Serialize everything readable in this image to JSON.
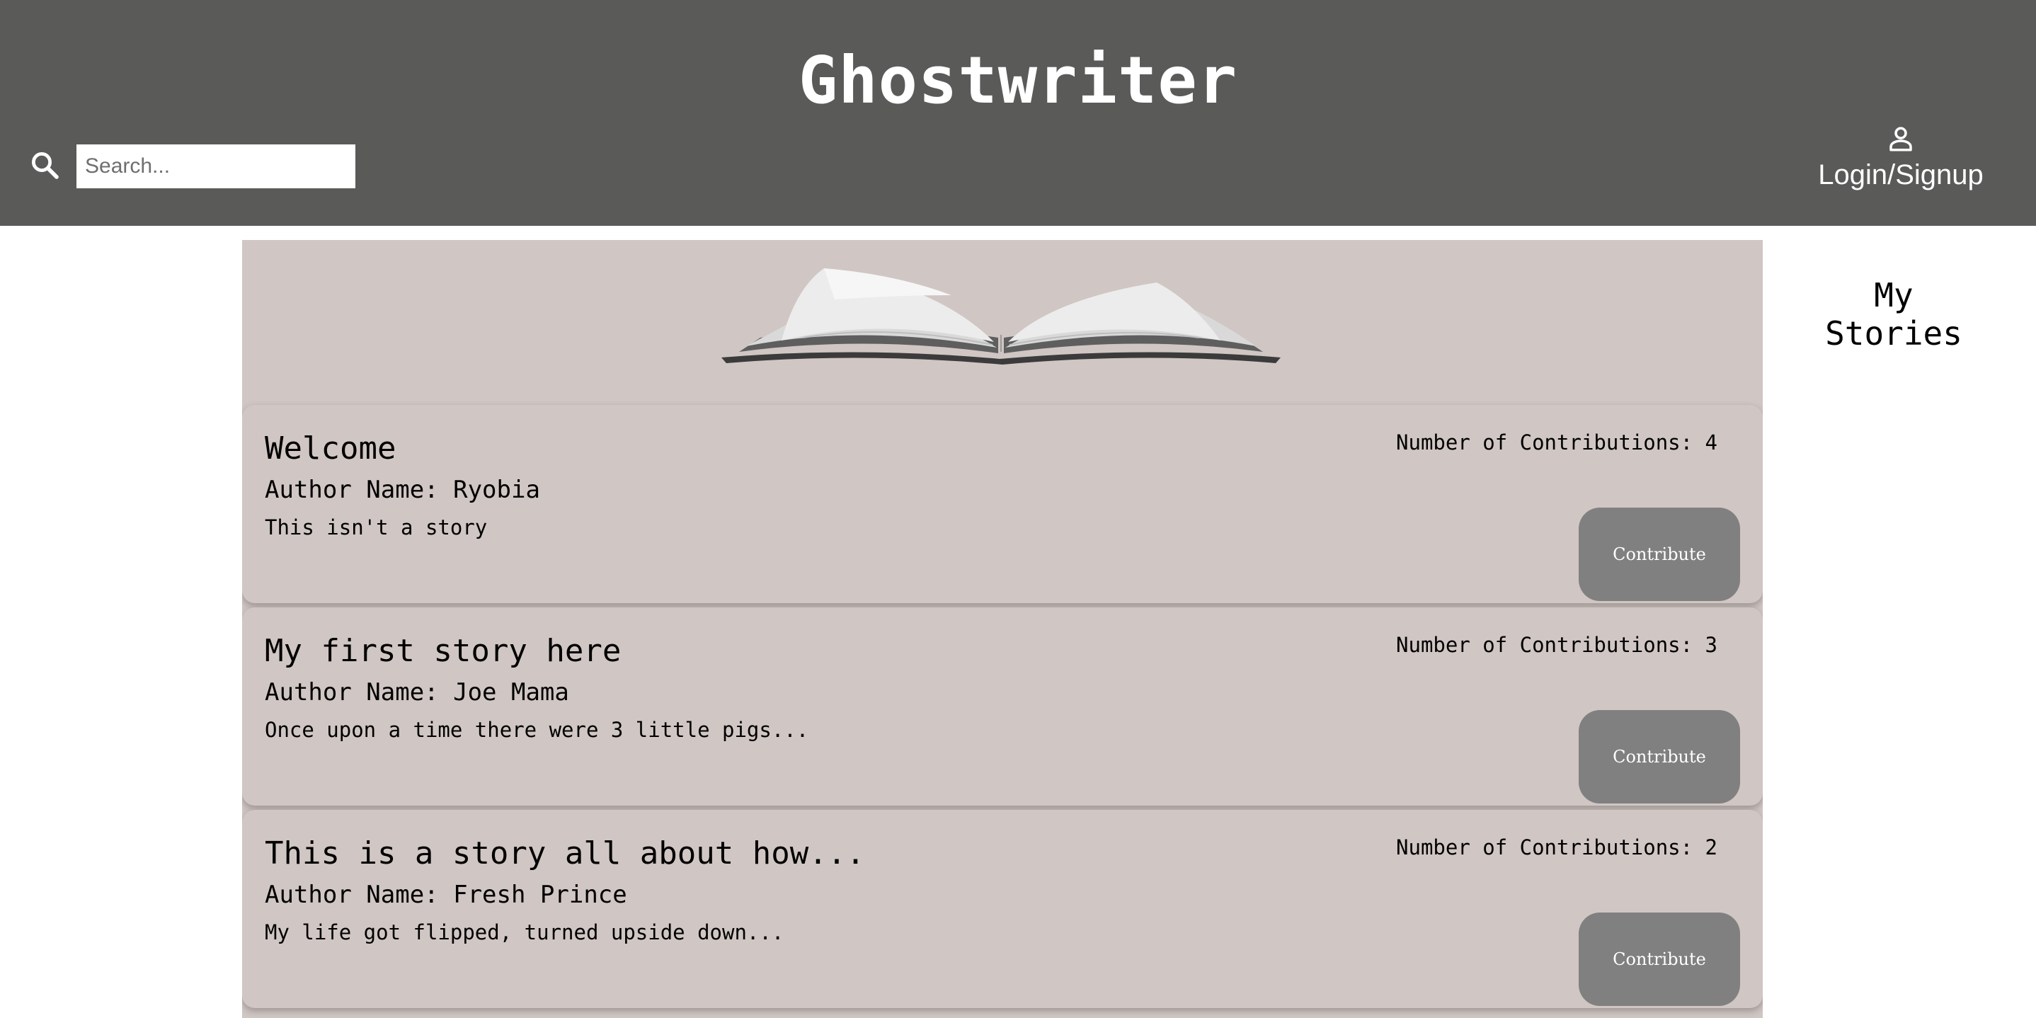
{
  "header": {
    "title": "Ghostwriter",
    "search_placeholder": "Search...",
    "search_value": "",
    "login_label": "Login/Signup",
    "background": "#5a5a59"
  },
  "icons": {
    "search": "search-icon",
    "user": "user-icon",
    "book": "open-book-illustration"
  },
  "sidebar": {
    "title": "My Stories"
  },
  "stories": [
    {
      "title": "Welcome",
      "author": "Author Name: Ryobia",
      "excerpt": "This isn't a story",
      "contributions": "Number of Contributions: 4",
      "button_label": "Contribute"
    },
    {
      "title": "My first story here",
      "author": "Author Name: Joe Mama",
      "excerpt": "Once upon a time there were 3 little pigs...",
      "contributions": "Number of Contributions: 3",
      "button_label": "Contribute"
    },
    {
      "title": "This is a story all about how...",
      "author": "Author Name: Fresh Prince",
      "excerpt": "My life got flipped, turned upside down...",
      "contributions": "Number of Contributions: 2",
      "button_label": "Contribute"
    }
  ],
  "colors": {
    "card_bg": "#d0c6c3",
    "button_bg": "#818080"
  }
}
